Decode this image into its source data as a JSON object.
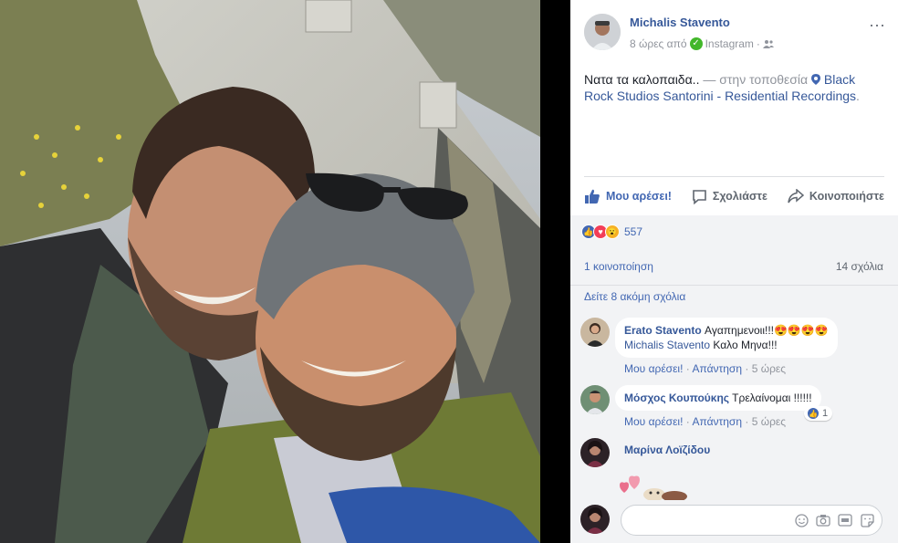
{
  "post": {
    "author": "Michalis Stavento",
    "time": "8 ώρες από",
    "source": "Instagram",
    "more": "···",
    "text": "Νατα τα καλοπαιδα..",
    "location_prefix": "— στην τοποθεσία",
    "location": "Black Rock Studios Santorini - Residential Recordings",
    "location_suffix": "."
  },
  "actions": {
    "like": "Μου αρέσει!",
    "comment": "Σχολιάστε",
    "share": "Κοινοποιήστε"
  },
  "reactions": {
    "count": "557"
  },
  "stats": {
    "shares": "1 κοινοποίηση",
    "comments": "14 σχόλια",
    "view_more": "Δείτε 8 ακόμη σχόλια"
  },
  "comments": [
    {
      "name": "Erato Stavento",
      "text": "Αγαπημενοιι!!!",
      "emoji": "😍😍😍😍",
      "mention": "Michalis Stavento",
      "text2": " Καλο Μηνα!!!",
      "like": "Μου αρέσει!",
      "reply": "Απάντηση",
      "time": "5 ώρες"
    },
    {
      "name": "Μόσχος Κουπούκης",
      "text": " Τρελαίνομαι !!!!!!",
      "like": "Μου αρέσει!",
      "reply": "Απάντηση",
      "time": "5 ώρες",
      "like_count": "1"
    },
    {
      "name": "Μαρίνα Λοϊζίδου"
    }
  ],
  "composer": {
    "placeholder": ""
  },
  "colors": {
    "link": "#365899",
    "accent": "#4267b2",
    "muted": "#90949c"
  }
}
